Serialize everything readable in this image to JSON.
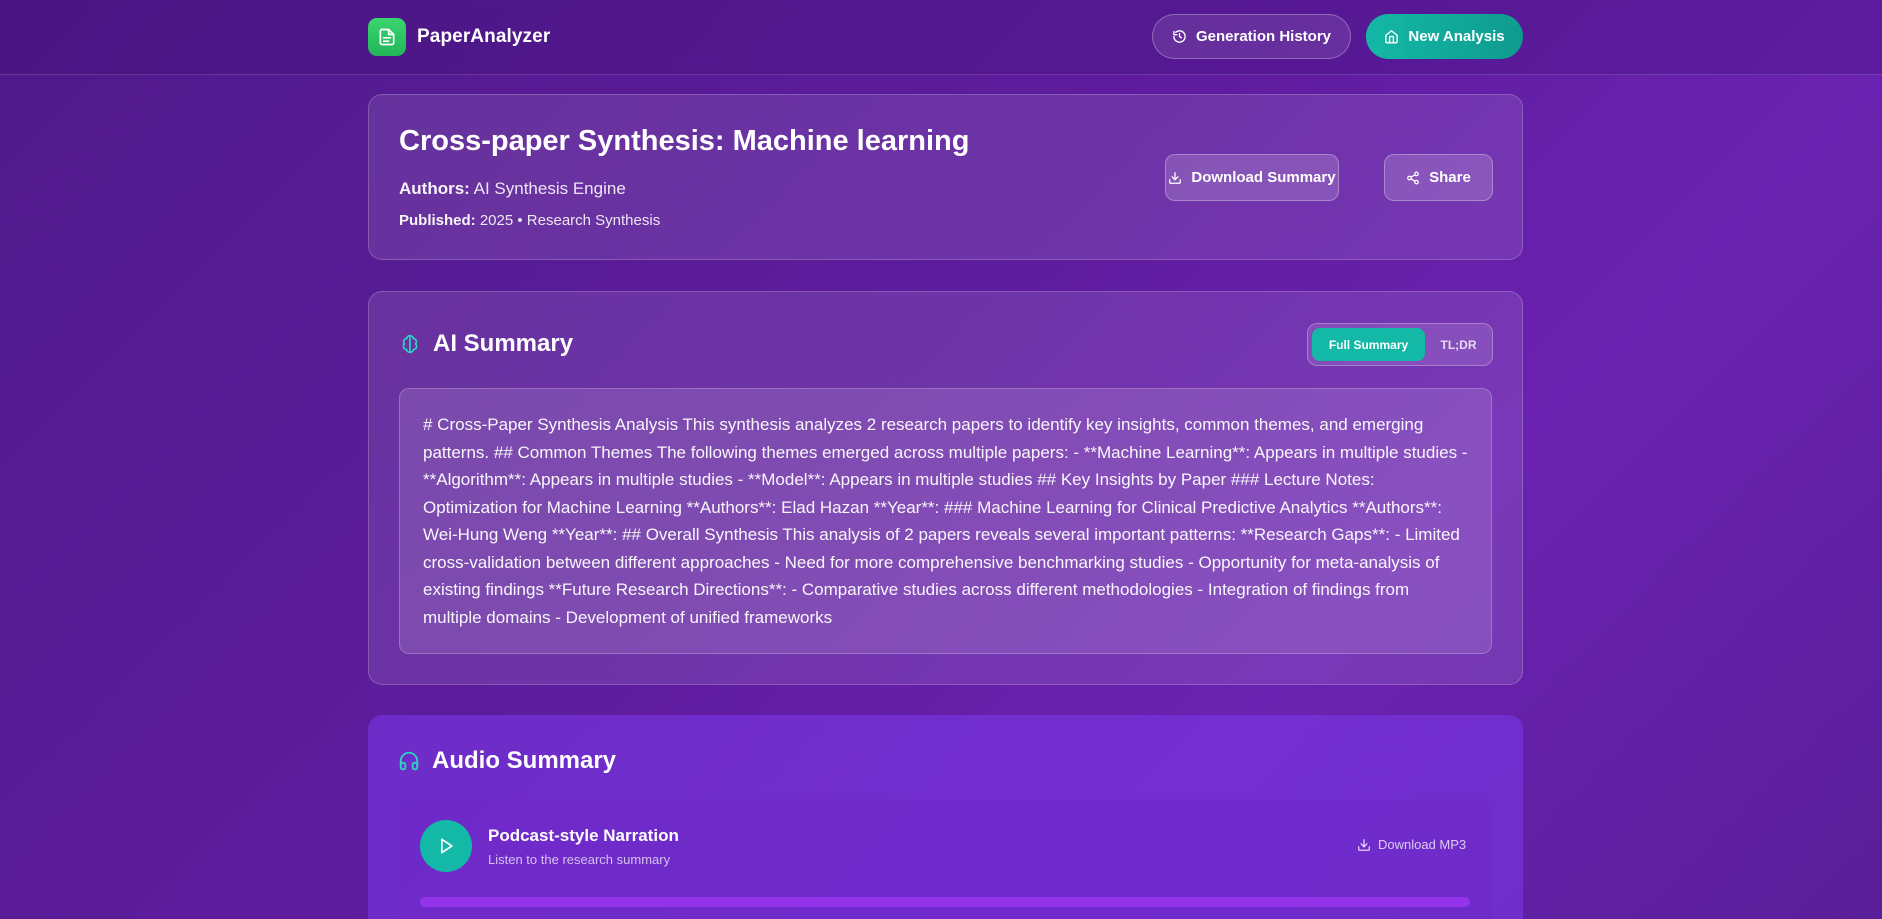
{
  "app": {
    "name": "PaperAnalyzer",
    "icon": "document-icon",
    "brand_color": "#22c55e",
    "accent_color": "#14b8a6"
  },
  "nav": {
    "history_label": "Generation History",
    "new_label": "New Analysis"
  },
  "paper": {
    "title": "Cross-paper Synthesis: Machine learning",
    "authors_label": "Authors:",
    "authors": "AI Synthesis Engine",
    "published_label": "Published:",
    "published": "2025 • Research Synthesis",
    "download_label": "Download Summary",
    "share_label": "Share"
  },
  "summary": {
    "title": "AI Summary",
    "icon": "brain-icon",
    "tabs": {
      "full": "Full Summary",
      "tldr": "TL;DR",
      "active": "full"
    },
    "text": "# Cross-Paper Synthesis Analysis This synthesis analyzes 2 research papers to identify key insights, common themes, and emerging patterns. ## Common Themes The following themes emerged across multiple papers: - **Machine Learning**: Appears in multiple studies - **Algorithm**: Appears in multiple studies - **Model**: Appears in multiple studies ## Key Insights by Paper ### Lecture Notes: Optimization for Machine Learning **Authors**: Elad Hazan **Year**: ### Machine Learning for Clinical Predictive Analytics **Authors**: Wei-Hung Weng **Year**: ## Overall Synthesis This analysis of 2 papers reveals several important patterns: **Research Gaps**: - Limited cross-validation between different approaches - Need for more comprehensive benchmarking studies - Opportunity for meta-analysis of existing findings **Future Research Directions**: - Comparative studies across different methodologies - Integration of findings from multiple domains - Development of unified frameworks"
  },
  "audio": {
    "title": "Audio Summary",
    "icon": "headphones-icon",
    "narration_title": "Podcast-style Narration",
    "narration_subtitle": "Listen to the research summary",
    "download_label": "Download MP3",
    "progress_fraction": 1.0,
    "progress_color": "#9333ea"
  }
}
